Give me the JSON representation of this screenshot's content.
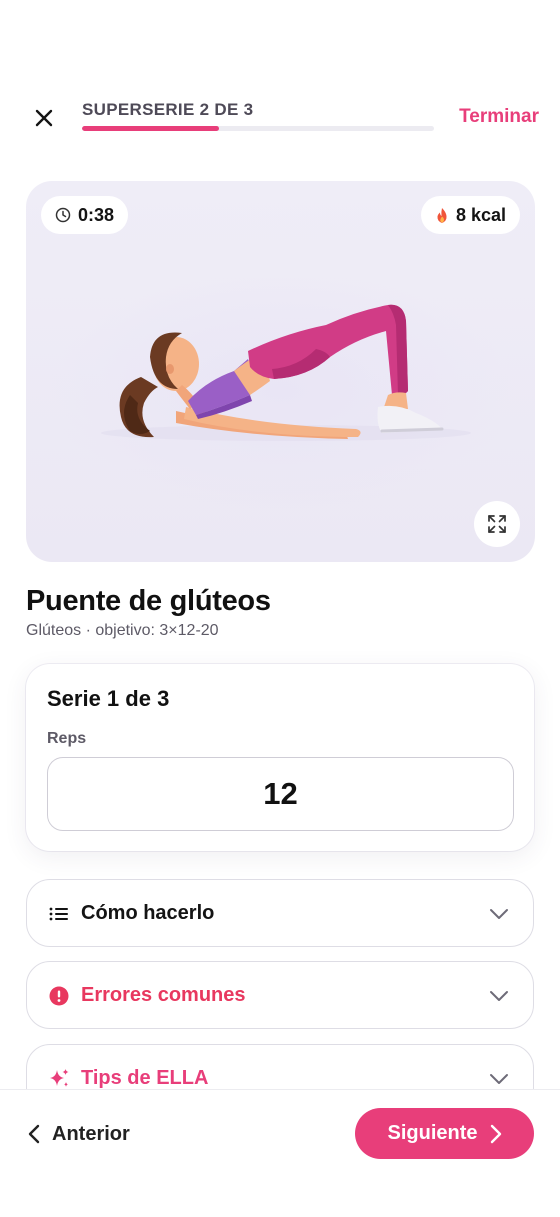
{
  "header": {
    "progress_label": "SUPERSERIE 2 DE 3",
    "progress_fraction": 0.39,
    "finish_label": "Terminar"
  },
  "hero": {
    "timer": "0:38",
    "kcal": "8 kcal"
  },
  "exercise": {
    "title": "Puente de glúteos",
    "subtitle": "Glúteos · objetivo: 3×12-20"
  },
  "set_card": {
    "title": "Serie 1 de 3",
    "reps_label": "Reps",
    "reps_value": "12"
  },
  "accordions": [
    {
      "label": "Cómo hacerlo",
      "icon": "list-icon"
    },
    {
      "label": "Errores comunes",
      "icon": "alert-icon"
    },
    {
      "label": "Tips de ELLA",
      "icon": "sparkles-icon"
    }
  ],
  "footer": {
    "prev_label": "Anterior",
    "next_label": "Siguiente"
  },
  "colors": {
    "accent": "#e83e7a",
    "error": "#e8385f",
    "hero_bg": "#efedf7"
  }
}
